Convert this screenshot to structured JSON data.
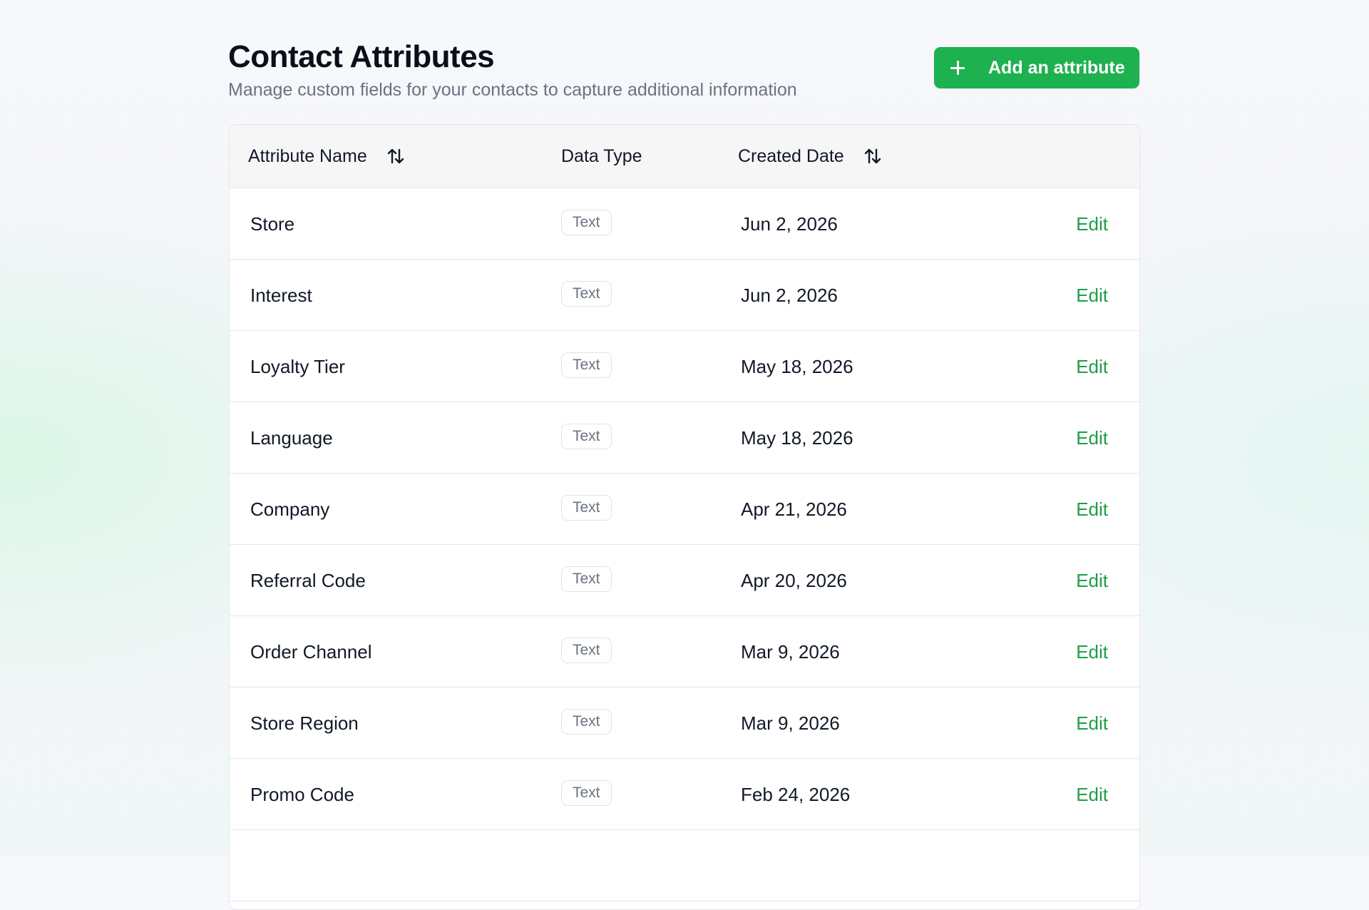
{
  "header": {
    "title": "Contact Attributes",
    "subtitle": "Manage custom fields for your contacts to capture additional information",
    "add_button_label": "Add an attribute"
  },
  "colors": {
    "accent": "#1eb14f",
    "link": "#1e9e48"
  },
  "table": {
    "columns": {
      "name": "Attribute Name",
      "type": "Data Type",
      "date": "Created Date"
    },
    "edit_label": "Edit",
    "rows": [
      {
        "name": "Store",
        "type": "Text",
        "date": "Jun 2, 2026"
      },
      {
        "name": "Interest",
        "type": "Text",
        "date": "Jun 2, 2026"
      },
      {
        "name": "Loyalty Tier",
        "type": "Text",
        "date": "May 18, 2026"
      },
      {
        "name": "Language",
        "type": "Text",
        "date": "May 18, 2026"
      },
      {
        "name": "Company",
        "type": "Text",
        "date": "Apr 21, 2026"
      },
      {
        "name": "Referral Code",
        "type": "Text",
        "date": "Apr 20, 2026"
      },
      {
        "name": "Order Channel",
        "type": "Text",
        "date": "Mar 9, 2026"
      },
      {
        "name": "Store Region",
        "type": "Text",
        "date": "Mar 9, 2026"
      },
      {
        "name": "Promo Code",
        "type": "Text",
        "date": "Feb 24, 2026"
      }
    ]
  }
}
